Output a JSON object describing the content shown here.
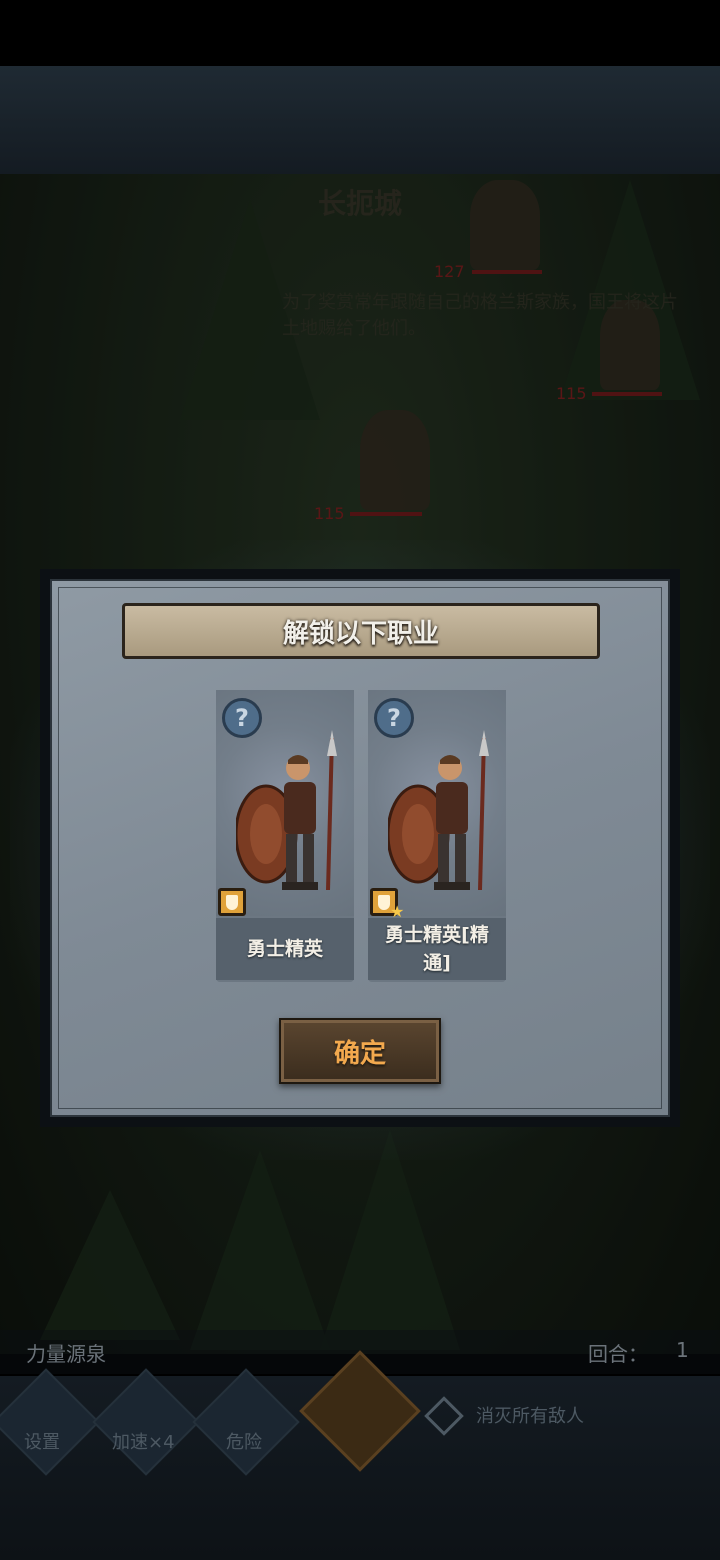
{
  "background": {
    "stage_title": "长扼城",
    "stage_description": "为了奖赏常年跟随自己的格兰斯家族，国王将这片土地赐给了他们。",
    "enemy_hp": [
      "127",
      "115",
      "115"
    ]
  },
  "hud": {
    "location_label": "力量源泉",
    "round_label": "回合：",
    "round_value": "1",
    "buttons": [
      {
        "label": "设置",
        "icon": "gear-icon"
      },
      {
        "label": "加速×4",
        "icon": "fast-forward-icon"
      },
      {
        "label": "危险",
        "icon": "exclamation-icon"
      }
    ],
    "objective": "消灭所有敌人"
  },
  "modal": {
    "title": "解锁以下职业",
    "cards": [
      {
        "name": "勇士精英",
        "badge": "shield-icon",
        "mastered": false
      },
      {
        "name": "勇士精英[精通]",
        "badge": "shield-icon",
        "mastered": true
      }
    ],
    "confirm_label": "确定"
  },
  "colors": {
    "banner": "#b9ab91",
    "panel": "#85909b",
    "confirm_text": "#f3a94e",
    "badge": "#e0a23a"
  }
}
